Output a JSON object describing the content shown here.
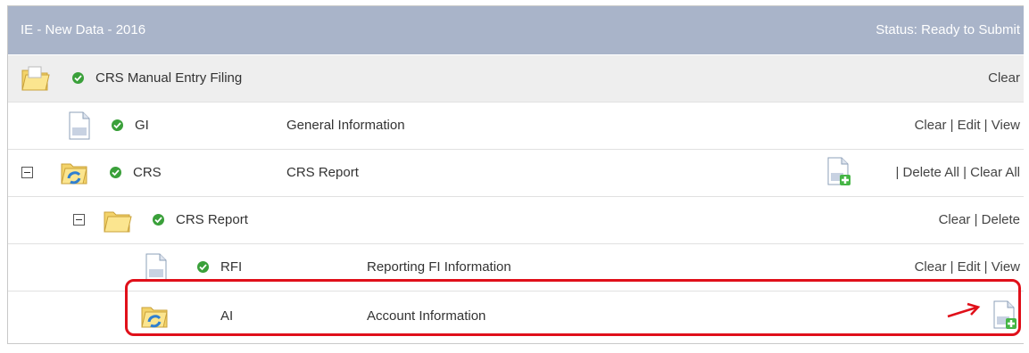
{
  "header": {
    "title": "IE - New Data - 2016",
    "status": "Status: Ready to Submit"
  },
  "rows": [
    {
      "code": "CRS Manual Entry Filing",
      "description": "",
      "icon": "folder-open-icon",
      "status": "check",
      "actions": "Clear"
    },
    {
      "code": "GI",
      "description": "General Information",
      "icon": "document-icon",
      "status": "check",
      "actions": "Clear | Edit | View"
    },
    {
      "code": "CRS",
      "description": "CRS Report",
      "icon": "folder-sync-icon",
      "status": "check",
      "collapse": "minus",
      "add_icon": "document-add-icon",
      "actions": "| Delete All | Clear All"
    },
    {
      "code": "CRS Report",
      "description": "",
      "icon": "folder-open-icon",
      "status": "check",
      "collapse": "minus",
      "actions": "Clear | Delete"
    },
    {
      "code": "RFI",
      "description": "Reporting FI Information",
      "icon": "document-icon",
      "status": "check",
      "actions": "Clear | Edit | View"
    },
    {
      "code": "AI",
      "description": "Account Information",
      "icon": "folder-sync-icon",
      "add_icon": "document-add-icon",
      "actions": ""
    }
  ],
  "colors": {
    "header_bg": "#a9b4c9",
    "check_green": "#3aa03a",
    "highlight_red": "#e0101a"
  }
}
